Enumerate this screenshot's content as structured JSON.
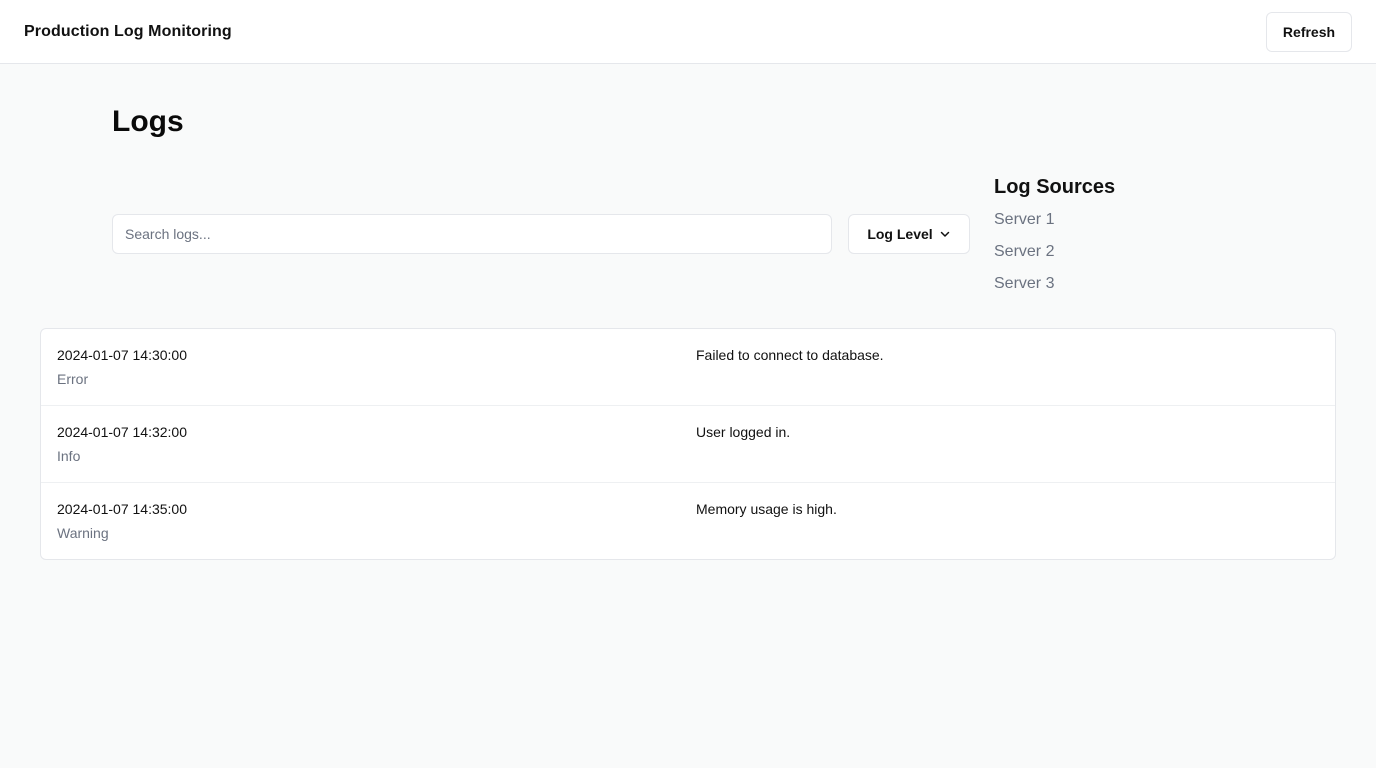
{
  "header": {
    "title": "Production Log Monitoring",
    "refresh_label": "Refresh"
  },
  "main": {
    "title": "Logs",
    "search": {
      "placeholder": "Search logs...",
      "value": ""
    },
    "level_filter_label": "Log Level",
    "level_filter_icon": "chevron-down-icon"
  },
  "sources": {
    "title": "Log Sources",
    "items": [
      {
        "label": "Server 1"
      },
      {
        "label": "Server 2"
      },
      {
        "label": "Server 3"
      }
    ]
  },
  "logs": [
    {
      "timestamp": "2024-01-07 14:30:00",
      "level": "Error",
      "message": "Failed to connect to database."
    },
    {
      "timestamp": "2024-01-07 14:32:00",
      "level": "Info",
      "message": "User logged in."
    },
    {
      "timestamp": "2024-01-07 14:35:00",
      "level": "Warning",
      "message": "Memory usage is high."
    }
  ],
  "colors": {
    "background": "#f9fafa",
    "surface": "#ffffff",
    "border": "#e5e7eb",
    "text": "#111111",
    "muted": "#6b7280"
  }
}
